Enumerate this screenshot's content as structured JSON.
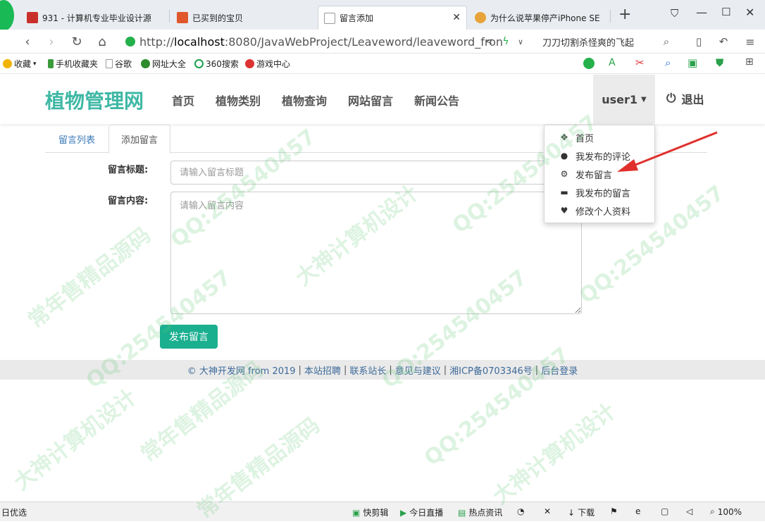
{
  "browser": {
    "tabs": [
      {
        "title": "931 - 计算机专业毕业设计源"
      },
      {
        "title": "已买到的宝贝"
      },
      {
        "title": "留言添加"
      },
      {
        "title": "为什么说苹果停产iPhone SE"
      }
    ],
    "new_tab_symbol": "+",
    "url_prefix": "http://",
    "url_host": "localhost",
    "url_rest": ":8080/JavaWebProject/Leaveword/leaveword_fron",
    "search_hint": "刀刀切割杀怪爽的飞起",
    "bookmarks": [
      {
        "label": "收藏",
        "icon": "star-icon",
        "color": "#f0b400"
      },
      {
        "label": "手机收藏夹",
        "icon": "phone-icon",
        "color": "#3b9b3b"
      },
      {
        "label": "谷歌",
        "icon": "page-icon",
        "color": "#999999"
      },
      {
        "label": "网址大全",
        "icon": "web-icon",
        "color": "#2e8b2e"
      },
      {
        "label": "360搜索",
        "icon": "search-360-icon",
        "color": "#1aa04a"
      },
      {
        "label": "游戏中心",
        "icon": "game-icon",
        "color": "#d33"
      }
    ]
  },
  "site": {
    "logo": "植物管理网",
    "nav": [
      "首页",
      "植物类别",
      "植物查询",
      "网站留言",
      "新闻公告"
    ],
    "user": "user1",
    "logout": "退出",
    "accent": "#3fb8a5"
  },
  "page_tabs": [
    "留言列表",
    "添加留言"
  ],
  "form": {
    "title_label": "留言标题:",
    "title_placeholder": "请输入留言标题",
    "content_label": "留言内容:",
    "content_placeholder": "请输入留言内容",
    "submit": "发布留言"
  },
  "footer": {
    "copyright": "© 大神开发网 from 2019",
    "links": [
      "本站招聘",
      "联系站长",
      "意见与建议",
      "湘ICP备0703346号",
      "后台登录"
    ]
  },
  "dropdown": {
    "items": [
      {
        "label": "首页",
        "icon": "move-icon",
        "glyph": "✥"
      },
      {
        "label": "我发布的评论",
        "icon": "user-icon",
        "glyph": "●"
      },
      {
        "label": "发布留言",
        "icon": "gear-icon",
        "glyph": "⚙"
      },
      {
        "label": "我发布的留言",
        "icon": "card-icon",
        "glyph": "▬"
      },
      {
        "label": "修改个人资料",
        "icon": "heart-icon",
        "glyph": "♥"
      }
    ]
  },
  "statusbar": {
    "left": "日优选",
    "items": [
      "快剪辑",
      "今日直播",
      "热点资讯",
      "下载"
    ],
    "zoom": "100%"
  },
  "watermark": {
    "qq": "QQ:25454045​7",
    "slogan1": "常年售精品源码",
    "slogan2": "大神计算机设计"
  }
}
